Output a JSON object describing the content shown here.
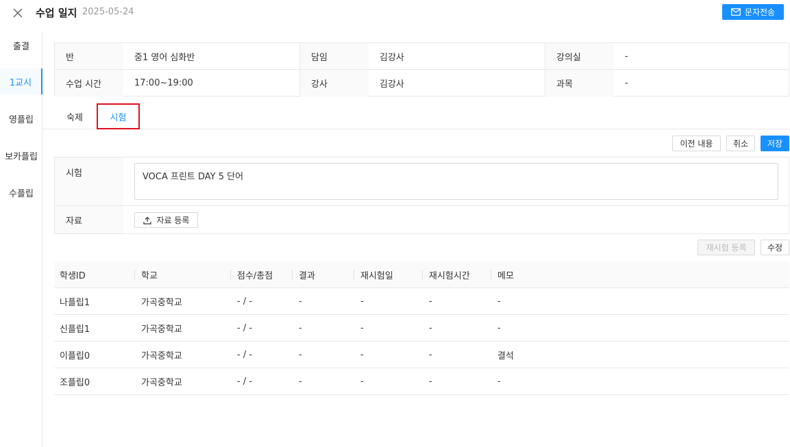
{
  "header": {
    "title": "수업 일지",
    "date": "2025-05-24",
    "sms_label": "문자전송"
  },
  "sidebar": {
    "items": [
      {
        "label": "출결"
      },
      {
        "label": "1교시"
      },
      {
        "label": "영플립"
      },
      {
        "label": "보카플립"
      },
      {
        "label": "수플립"
      }
    ]
  },
  "info": {
    "class_label": "반",
    "class_value": "중1 영어 심화반",
    "homeroom_label": "담임",
    "homeroom_value": "김강사",
    "room_label": "강의실",
    "room_value": "-",
    "time_label": "수업 시간",
    "time_value": "17:00~19:00",
    "teacher_label": "강사",
    "teacher_value": "김강사",
    "subject_label": "과목",
    "subject_value": "-"
  },
  "tabs": [
    {
      "label": "숙제"
    },
    {
      "label": "시험"
    }
  ],
  "actions": {
    "previous_label": "이전 내용",
    "cancel_label": "취소",
    "save_label": "저장",
    "retest_label": "재시험 등록",
    "edit_label": "수정"
  },
  "exam_form": {
    "exam_label": "시험",
    "exam_value": "VOCA 프린트 DAY 5 단어",
    "material_label": "자료",
    "upload_label": "자료 등록"
  },
  "results": {
    "columns": [
      "학생ID",
      "학교",
      "점수/총점",
      "결과",
      "재시험일",
      "재시험시간",
      "메모"
    ],
    "rows": [
      [
        "나플립1",
        "가곡중학교",
        "- / -",
        "-",
        "-",
        "-",
        "-"
      ],
      [
        "신플립1",
        "가곡중학교",
        "- / -",
        "-",
        "-",
        "-",
        "-"
      ],
      [
        "이플립0",
        "가곡중학교",
        "- / -",
        "-",
        "-",
        "-",
        "결석"
      ],
      [
        "조플립0",
        "가곡중학교",
        "- / -",
        "-",
        "-",
        "-",
        "-"
      ]
    ]
  },
  "colors": {
    "accent": "#1890ff",
    "highlight_border": "#e0111c"
  }
}
